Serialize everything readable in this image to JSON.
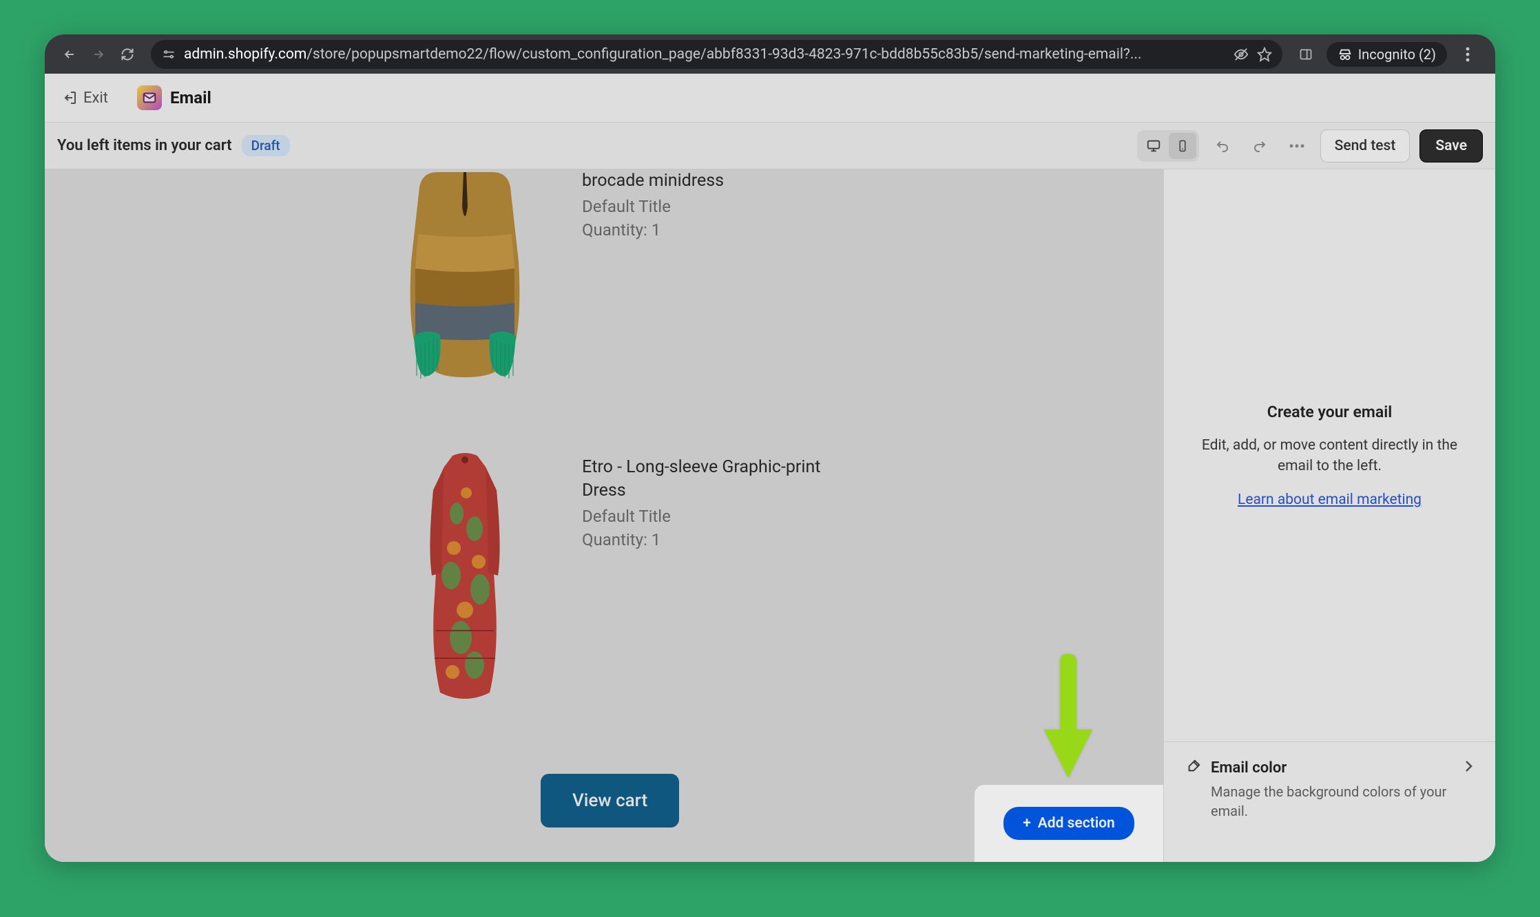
{
  "browser": {
    "url_host": "admin.shopify.com",
    "url_path": "/store/popupsmartdemo22/flow/custom_configuration_page/abbf8331-93d3-4823-971c-bdd8b55c83b5/send-marketing-email?...",
    "incognito_label": "Incognito (2)"
  },
  "app": {
    "exit_label": "Exit",
    "title": "Email"
  },
  "subheader": {
    "subject": "You left items in your cart",
    "status": "Draft",
    "send_test_label": "Send test",
    "save_label": "Save"
  },
  "canvas": {
    "products": [
      {
        "name": "brocade minidress",
        "variant": "Default Title",
        "quantity_label": "Quantity: 1"
      },
      {
        "name": "Etro - Long-sleeve Graphic-print Dress",
        "variant": "Default Title",
        "quantity_label": "Quantity: 1"
      }
    ],
    "view_cart_label": "View cart",
    "add_section_label": "Add section"
  },
  "sidebar": {
    "create_title": "Create your email",
    "create_desc": "Edit, add, or move content directly in the email to the left.",
    "learn_link": "Learn about email marketing",
    "color_title": "Email color",
    "color_desc": "Manage the background colors of your email."
  }
}
